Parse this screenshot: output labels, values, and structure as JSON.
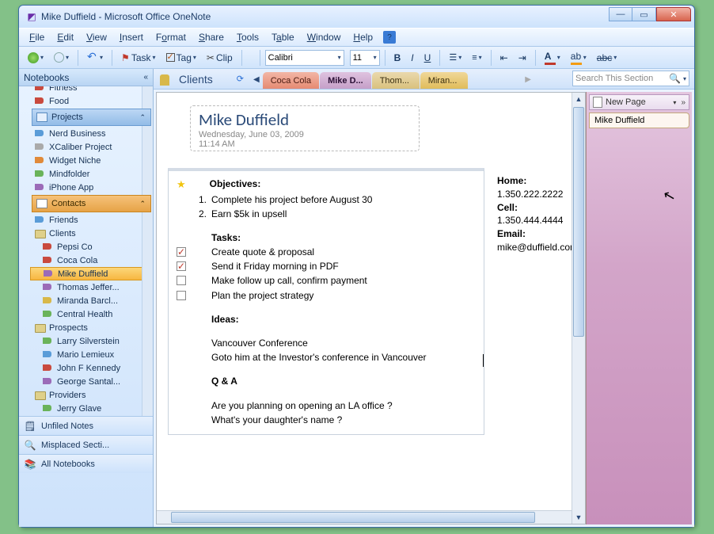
{
  "window": {
    "title": "Mike Duffield - Microsoft Office OneNote"
  },
  "menus": {
    "file": "File",
    "edit": "Edit",
    "view": "View",
    "insert": "Insert",
    "format": "Format",
    "share": "Share",
    "tools": "Tools",
    "table": "Table",
    "window": "Window",
    "help": "Help"
  },
  "toolbar": {
    "task": "Task",
    "tag": "Tag",
    "clip": "Clip",
    "font": "Calibri",
    "size": "11"
  },
  "sidebar": {
    "header": "Notebooks",
    "top_items": [
      {
        "label": "Fitness"
      },
      {
        "label": "Food"
      }
    ],
    "projects_header": "Projects",
    "projects": [
      {
        "label": "Nerd Business"
      },
      {
        "label": "XCaliber Project"
      },
      {
        "label": "Widget Niche"
      },
      {
        "label": "Mindfolder"
      },
      {
        "label": "iPhone App"
      }
    ],
    "contacts_header": "Contacts",
    "friends": "Friends",
    "clients": "Clients",
    "client_items": [
      {
        "label": "Pepsi Co"
      },
      {
        "label": "Coca Cola"
      },
      {
        "label": "Mike Duffield"
      },
      {
        "label": "Thomas Jeffer..."
      },
      {
        "label": "Miranda Barcl..."
      },
      {
        "label": "Central Health"
      }
    ],
    "prospects": "Prospects",
    "prospect_items": [
      {
        "label": "Larry Silverstein"
      },
      {
        "label": "Mario Lemieux"
      },
      {
        "label": "John F Kennedy"
      },
      {
        "label": "George Santal..."
      }
    ],
    "providers": "Providers",
    "provider_items": [
      {
        "label": "Jerry Glave"
      }
    ],
    "unfiled": "Unfiled Notes",
    "misplaced": "Misplaced Secti...",
    "all": "All Notebooks"
  },
  "tabs": {
    "section": "Clients",
    "coke": "Coca Cola",
    "active": "Mike D...",
    "thomas": "Thom...",
    "miranda": "Miran..."
  },
  "search": {
    "placeholder": "Search This Section"
  },
  "page": {
    "title": "Mike Duffield",
    "date": "Wednesday, June 03, 2009",
    "time": "11:14 AM",
    "objectives_label": "Objectives:",
    "obj1": "Complete his project before August 30",
    "obj2": "Earn $5k in upsell",
    "tasks_label": "Tasks:",
    "t1": "Create quote & proposal",
    "t2": "Send it Friday morning in PDF",
    "t3": "Make follow up call, confirm payment",
    "t4": "Plan the project strategy",
    "ideas_label": "Ideas:",
    "idea1": "Vancouver Conference",
    "idea2": "Goto him at the Investor's conference in Vancouver",
    "qa_label": "Q & A",
    "qa1": "Are you planning on opening an LA office ?",
    "qa2": "What's your daughter's name ?",
    "home": "1.350.222.2222",
    "cell": "1.350.444.4444",
    "email": "mike@duffield.com"
  },
  "pagelist": {
    "new": "New Page",
    "item": "Mike Duffield"
  }
}
